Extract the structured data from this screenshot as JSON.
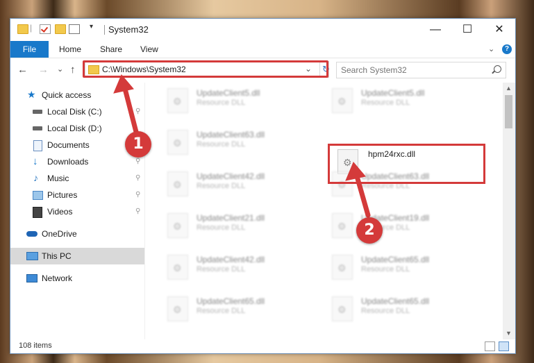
{
  "window": {
    "title": "System32",
    "controls": {
      "minimize": "—",
      "maximize": "☐",
      "close": "✕"
    }
  },
  "ribbon": {
    "tabs": [
      {
        "label": "File"
      },
      {
        "label": "Home"
      },
      {
        "label": "Share"
      },
      {
        "label": "View"
      }
    ],
    "help": "?"
  },
  "nav": {
    "back": "←",
    "forward": "→",
    "recent": "⌄",
    "up": "↑",
    "address": "C:\\Windows\\System32",
    "refresh": "↻",
    "dropdown": "⌄"
  },
  "search": {
    "placeholder": "Search System32"
  },
  "sidebar": {
    "items": [
      {
        "label": "Quick access",
        "icon": "star-icon"
      },
      {
        "label": "Local Disk (C:)",
        "icon": "drive-icon",
        "pinned": true
      },
      {
        "label": "Local Disk (D:)",
        "icon": "drive-icon"
      },
      {
        "label": "Documents",
        "icon": "documents-icon",
        "pinned": true
      },
      {
        "label": "Downloads",
        "icon": "download-icon",
        "pinned": true
      },
      {
        "label": "Music",
        "icon": "music-icon",
        "pinned": true
      },
      {
        "label": "Pictures",
        "icon": "pictures-icon",
        "pinned": true
      },
      {
        "label": "Videos",
        "icon": "videos-icon",
        "pinned": true
      },
      {
        "label": "OneDrive",
        "icon": "cloud-icon"
      },
      {
        "label": "This PC",
        "icon": "computer-icon",
        "selected": true
      },
      {
        "label": "Network",
        "icon": "network-icon"
      }
    ],
    "pin_glyph": "📌"
  },
  "files": {
    "left": [
      {
        "name": "UpdateClient5.dll",
        "type": "Resource DLL"
      },
      {
        "name": "UpdateClient63.dll",
        "type": "Resource DLL"
      },
      {
        "name": "UpdateClient42.dll",
        "type": "Resource DLL"
      },
      {
        "name": "UpdateClient21.dll",
        "type": "Resource DLL"
      },
      {
        "name": "UpdateClient42.dll",
        "type": "Resource DLL"
      },
      {
        "name": "UpdateClient65.dll",
        "type": "Resource DLL"
      }
    ],
    "right": [
      {
        "name": "UpdateClient5.dll",
        "type": "Resource DLL"
      },
      {
        "name": "hpm24rxc.dll",
        "type": "",
        "highlighted": true
      },
      {
        "name": "UpdateClient63.dll",
        "type": "Resource DLL"
      },
      {
        "name": "UpdateClient19.dll",
        "type": "Resource DLL"
      },
      {
        "name": "UpdateClient65.dll",
        "type": "Resource DLL"
      },
      {
        "name": "UpdateClient65.dll",
        "type": "Resource DLL"
      }
    ]
  },
  "status": {
    "item_count": "108 items"
  },
  "callouts": {
    "step1": "1",
    "step2": "2",
    "color": "#d43a3a"
  },
  "scrollbar": {
    "up": "▲",
    "down": "▼"
  }
}
